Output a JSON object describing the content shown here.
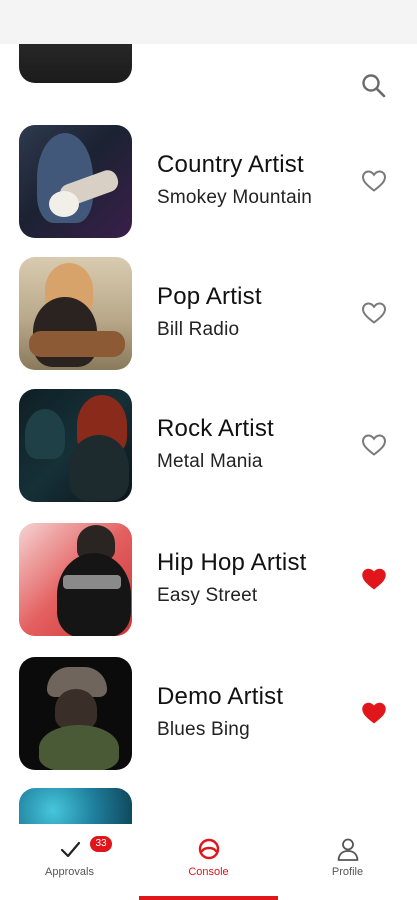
{
  "colors": {
    "accent": "#e0161b",
    "heart_outline": "#7a7a7a",
    "heart_filled": "#e0161b"
  },
  "header": {
    "search_icon": "search-icon"
  },
  "artists": [
    {
      "title": "Country Artist",
      "subtitle": "Smokey Mountain",
      "favorite": false
    },
    {
      "title": "Pop Artist",
      "subtitle": "Bill Radio",
      "favorite": false
    },
    {
      "title": "Rock Artist",
      "subtitle": "Metal Mania",
      "favorite": false
    },
    {
      "title": "Hip Hop Artist",
      "subtitle": "Easy Street",
      "favorite": true
    },
    {
      "title": "Demo Artist",
      "subtitle": "Blues Bing",
      "favorite": true
    }
  ],
  "tabbar": {
    "tabs": [
      {
        "label": "Approvals",
        "icon": "check-icon",
        "badge": "33"
      },
      {
        "label": "Console",
        "icon": "console-icon",
        "active": true
      },
      {
        "label": "Profile",
        "icon": "profile-icon"
      }
    ]
  }
}
